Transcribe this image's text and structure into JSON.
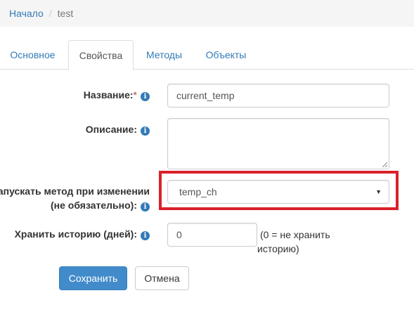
{
  "breadcrumb": {
    "home": "Начало",
    "separator": "/",
    "current": "test"
  },
  "tabs": [
    {
      "label": "Основное",
      "active": false
    },
    {
      "label": "Свойства",
      "active": true
    },
    {
      "label": "Методы",
      "active": false
    },
    {
      "label": "Объекты",
      "active": false
    }
  ],
  "form": {
    "name": {
      "label": "Название:",
      "required_mark": "*",
      "value": "current_temp"
    },
    "description": {
      "label": "Описание:",
      "value": ""
    },
    "on_change_method": {
      "label_line1": "Запускать метод при изменении",
      "label_line2": "(не обязательно):",
      "value": "temp_ch"
    },
    "history": {
      "label": "Хранить историю (дней):",
      "value": "0",
      "hint_line1": "(0 = не хранить",
      "hint_line2": "историю)"
    },
    "info_glyph": "i"
  },
  "buttons": {
    "save": "Сохранить",
    "cancel": "Отмена"
  },
  "colors": {
    "link": "#337ab7",
    "primary": "#428bca",
    "highlight": "#d9222a",
    "required": "#a94442"
  }
}
